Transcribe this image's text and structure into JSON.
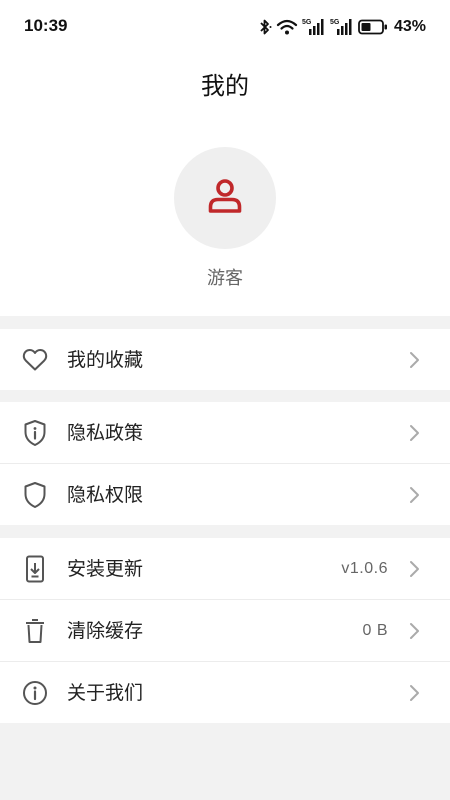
{
  "status_bar": {
    "time": "10:39",
    "battery_percent": "43%",
    "network_labels": [
      "5G",
      "5G"
    ],
    "icons": [
      "bluetooth-icon",
      "wifi-icon",
      "signal-5g-icon",
      "signal-5g-icon",
      "battery-icon"
    ]
  },
  "header": {
    "title": "我的"
  },
  "profile": {
    "name": "游客",
    "avatar_icon": "user-icon",
    "accent_color": "#c0282a"
  },
  "menu": {
    "favorites": {
      "label": "我的收藏",
      "icon": "heart-icon"
    },
    "privacy_policy": {
      "label": "隐私政策",
      "icon": "shield-info-icon"
    },
    "privacy_permissions": {
      "label": "隐私权限",
      "icon": "shield-icon"
    },
    "install_update": {
      "label": "安装更新",
      "value": "v1.0.6",
      "icon": "download-phone-icon"
    },
    "clear_cache": {
      "label": "清除缓存",
      "value": "0 B",
      "icon": "trash-icon"
    },
    "about_us": {
      "label": "关于我们",
      "icon": "info-icon"
    }
  },
  "colors": {
    "background": "#f2f2f2",
    "card": "#ffffff",
    "icon": "#555555",
    "accent": "#c0282a"
  }
}
